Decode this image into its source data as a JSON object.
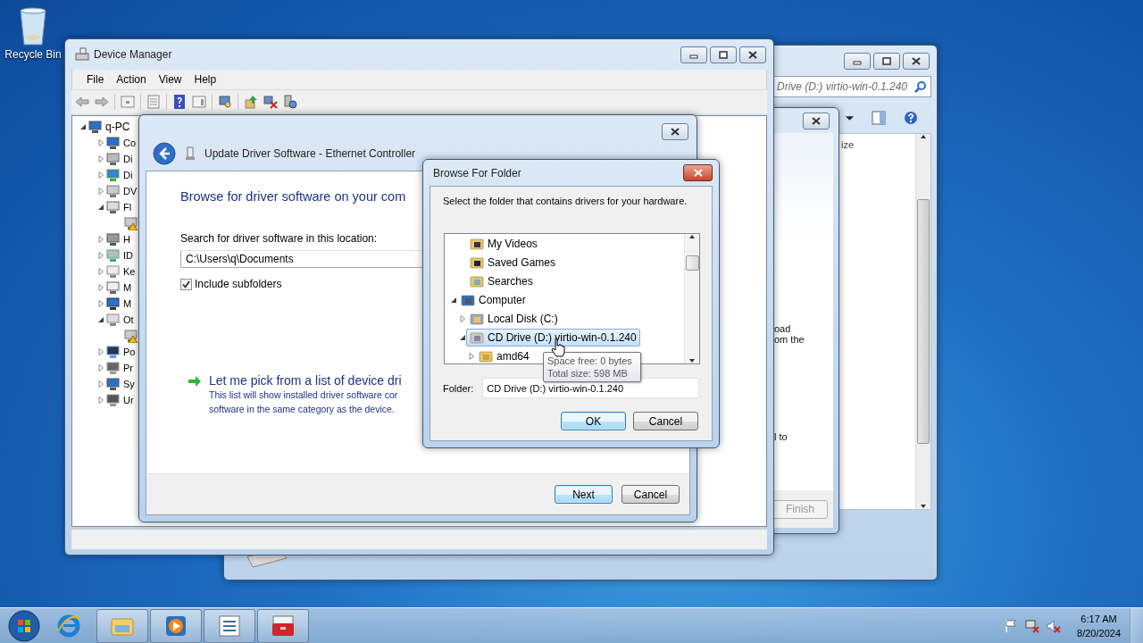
{
  "desktop": {
    "icons": [
      {
        "label": "Recycle Bin"
      }
    ]
  },
  "explorer_window": {
    "address": "Drive (D:) virtio-win-0.1.240",
    "column_header": "ize"
  },
  "background_wizard": {
    "texts": [
      "oad",
      "om the",
      "l to"
    ],
    "finish_button": {
      "label": "Finish",
      "disabled": true
    }
  },
  "device_manager": {
    "title": "Device Manager",
    "menu": [
      "File",
      "Action",
      "View",
      "Help"
    ],
    "tree": {
      "label": "q-PC",
      "kind": "computer",
      "expanded": true,
      "children": [
        {
          "label": "Co",
          "kind": "computer",
          "expanded": false
        },
        {
          "label": "Di",
          "kind": "disk",
          "expanded": false
        },
        {
          "label": "Di",
          "kind": "display",
          "expanded": false
        },
        {
          "label": "DV",
          "kind": "dvd",
          "expanded": false
        },
        {
          "label": "Fl",
          "kind": "floppy",
          "expanded": true,
          "children": [
            {
              "kind": "warning"
            }
          ]
        },
        {
          "label": "H",
          "kind": "hid",
          "expanded": false
        },
        {
          "label": "ID",
          "kind": "ide",
          "expanded": false
        },
        {
          "label": "Ke",
          "kind": "keyboard",
          "expanded": false
        },
        {
          "label": "M",
          "kind": "mouse",
          "expanded": false
        },
        {
          "label": "M",
          "kind": "monitor",
          "expanded": false
        },
        {
          "label": "Ot",
          "kind": "other",
          "expanded": true,
          "children": [
            {
              "kind": "warning"
            }
          ]
        },
        {
          "label": "Po",
          "kind": "port",
          "expanded": false
        },
        {
          "label": "Pr",
          "kind": "processor",
          "expanded": false
        },
        {
          "label": "Sy",
          "kind": "computer",
          "expanded": false
        },
        {
          "label": "Ur",
          "kind": "usb",
          "expanded": false
        }
      ]
    }
  },
  "update_driver_dialog": {
    "title": "Update Driver Software - Ethernet Controller",
    "heading": "Browse for driver software on your com",
    "location_label": "Search for driver software in this location:",
    "location_value": "C:\\Users\\q\\Documents",
    "include_subfolders": {
      "label": "Include subfolders",
      "checked": true
    },
    "pick_option": {
      "title": "Let me pick from a list of device dri",
      "description": [
        "This list will show installed driver software cor",
        "software in the same category as the device."
      ]
    },
    "buttons": [
      {
        "label": "Next",
        "default": true
      },
      {
        "label": "Cancel",
        "default": false
      }
    ]
  },
  "browse_for_folder": {
    "title": "Browse For Folder",
    "instruction": "Select the folder that contains drivers for your hardware.",
    "scrolled_children": [
      {
        "label": "My Videos",
        "kind": "videos",
        "selected": false
      },
      {
        "label": "Saved Games",
        "kind": "games",
        "selected": false
      },
      {
        "label": "Searches",
        "kind": "searches",
        "selected": false
      }
    ],
    "tree": [
      {
        "label": "Computer",
        "kind": "computer",
        "expanded": true,
        "selected": false,
        "children": [
          {
            "label": "Local Disk (C:)",
            "kind": "disk",
            "expanded": false,
            "selected": false
          },
          {
            "label": "CD Drive (D:) virtio-win-0.1.240",
            "kind": "cd",
            "expanded": true,
            "selected": true,
            "children": [
              {
                "label": "amd64",
                "kind": "folder",
                "expanded": false,
                "selected": false
              }
            ]
          }
        ]
      }
    ],
    "tooltip": [
      "Space free: 0 bytes",
      "Total size: 598 MB"
    ],
    "folder_label": "Folder:",
    "folder_value": "CD Drive (D:) virtio-win-0.1.240",
    "buttons": [
      {
        "label": "OK",
        "default": true
      },
      {
        "label": "Cancel",
        "default": false
      }
    ]
  },
  "taskbar": {
    "items": [
      {
        "kind": "ie",
        "running": false
      },
      {
        "kind": "explorer",
        "running": true
      },
      {
        "kind": "media",
        "running": true
      },
      {
        "kind": "list",
        "running": true
      },
      {
        "kind": "toolbox",
        "running": true
      }
    ],
    "clock": {
      "time": "6:17 AM",
      "date": "8/20/2024"
    }
  }
}
